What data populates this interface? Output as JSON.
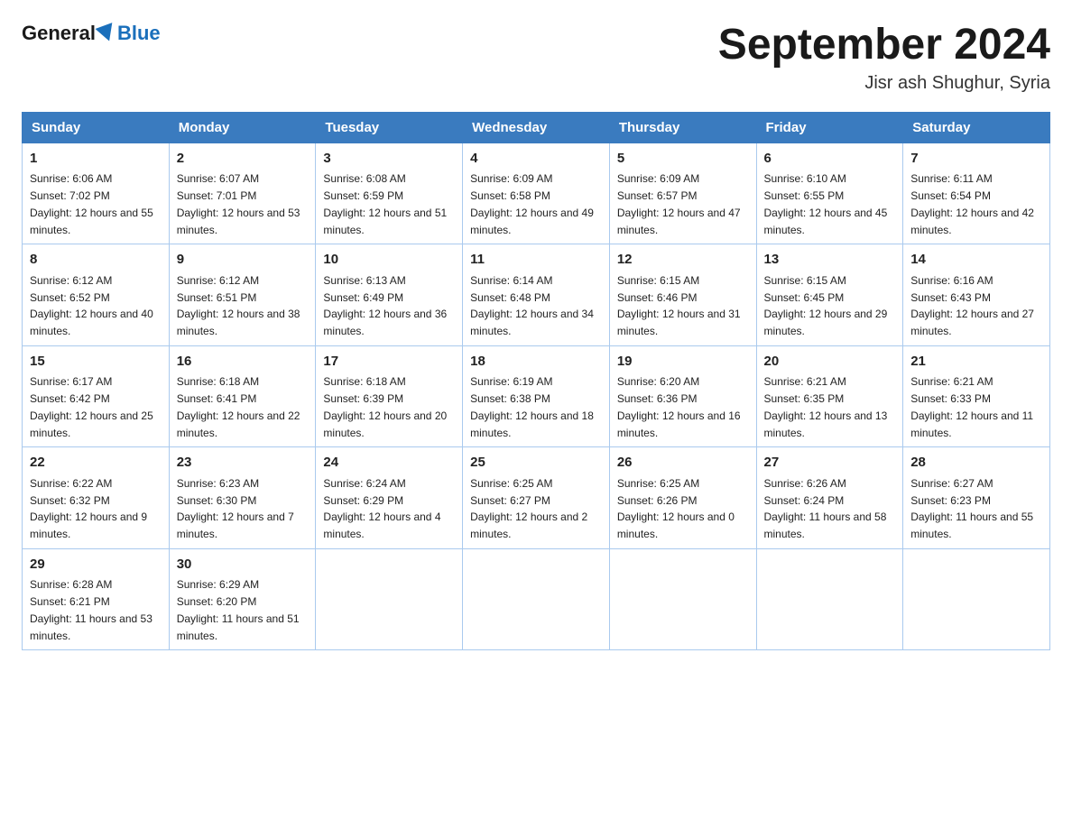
{
  "header": {
    "logo_general": "General",
    "logo_blue": "Blue",
    "month_title": "September 2024",
    "location": "Jisr ash Shughur, Syria"
  },
  "days_of_week": [
    "Sunday",
    "Monday",
    "Tuesday",
    "Wednesday",
    "Thursday",
    "Friday",
    "Saturday"
  ],
  "weeks": [
    [
      {
        "day": "1",
        "sunrise": "6:06 AM",
        "sunset": "7:02 PM",
        "daylight": "12 hours and 55 minutes."
      },
      {
        "day": "2",
        "sunrise": "6:07 AM",
        "sunset": "7:01 PM",
        "daylight": "12 hours and 53 minutes."
      },
      {
        "day": "3",
        "sunrise": "6:08 AM",
        "sunset": "6:59 PM",
        "daylight": "12 hours and 51 minutes."
      },
      {
        "day": "4",
        "sunrise": "6:09 AM",
        "sunset": "6:58 PM",
        "daylight": "12 hours and 49 minutes."
      },
      {
        "day": "5",
        "sunrise": "6:09 AM",
        "sunset": "6:57 PM",
        "daylight": "12 hours and 47 minutes."
      },
      {
        "day": "6",
        "sunrise": "6:10 AM",
        "sunset": "6:55 PM",
        "daylight": "12 hours and 45 minutes."
      },
      {
        "day": "7",
        "sunrise": "6:11 AM",
        "sunset": "6:54 PM",
        "daylight": "12 hours and 42 minutes."
      }
    ],
    [
      {
        "day": "8",
        "sunrise": "6:12 AM",
        "sunset": "6:52 PM",
        "daylight": "12 hours and 40 minutes."
      },
      {
        "day": "9",
        "sunrise": "6:12 AM",
        "sunset": "6:51 PM",
        "daylight": "12 hours and 38 minutes."
      },
      {
        "day": "10",
        "sunrise": "6:13 AM",
        "sunset": "6:49 PM",
        "daylight": "12 hours and 36 minutes."
      },
      {
        "day": "11",
        "sunrise": "6:14 AM",
        "sunset": "6:48 PM",
        "daylight": "12 hours and 34 minutes."
      },
      {
        "day": "12",
        "sunrise": "6:15 AM",
        "sunset": "6:46 PM",
        "daylight": "12 hours and 31 minutes."
      },
      {
        "day": "13",
        "sunrise": "6:15 AM",
        "sunset": "6:45 PM",
        "daylight": "12 hours and 29 minutes."
      },
      {
        "day": "14",
        "sunrise": "6:16 AM",
        "sunset": "6:43 PM",
        "daylight": "12 hours and 27 minutes."
      }
    ],
    [
      {
        "day": "15",
        "sunrise": "6:17 AM",
        "sunset": "6:42 PM",
        "daylight": "12 hours and 25 minutes."
      },
      {
        "day": "16",
        "sunrise": "6:18 AM",
        "sunset": "6:41 PM",
        "daylight": "12 hours and 22 minutes."
      },
      {
        "day": "17",
        "sunrise": "6:18 AM",
        "sunset": "6:39 PM",
        "daylight": "12 hours and 20 minutes."
      },
      {
        "day": "18",
        "sunrise": "6:19 AM",
        "sunset": "6:38 PM",
        "daylight": "12 hours and 18 minutes."
      },
      {
        "day": "19",
        "sunrise": "6:20 AM",
        "sunset": "6:36 PM",
        "daylight": "12 hours and 16 minutes."
      },
      {
        "day": "20",
        "sunrise": "6:21 AM",
        "sunset": "6:35 PM",
        "daylight": "12 hours and 13 minutes."
      },
      {
        "day": "21",
        "sunrise": "6:21 AM",
        "sunset": "6:33 PM",
        "daylight": "12 hours and 11 minutes."
      }
    ],
    [
      {
        "day": "22",
        "sunrise": "6:22 AM",
        "sunset": "6:32 PM",
        "daylight": "12 hours and 9 minutes."
      },
      {
        "day": "23",
        "sunrise": "6:23 AM",
        "sunset": "6:30 PM",
        "daylight": "12 hours and 7 minutes."
      },
      {
        "day": "24",
        "sunrise": "6:24 AM",
        "sunset": "6:29 PM",
        "daylight": "12 hours and 4 minutes."
      },
      {
        "day": "25",
        "sunrise": "6:25 AM",
        "sunset": "6:27 PM",
        "daylight": "12 hours and 2 minutes."
      },
      {
        "day": "26",
        "sunrise": "6:25 AM",
        "sunset": "6:26 PM",
        "daylight": "12 hours and 0 minutes."
      },
      {
        "day": "27",
        "sunrise": "6:26 AM",
        "sunset": "6:24 PM",
        "daylight": "11 hours and 58 minutes."
      },
      {
        "day": "28",
        "sunrise": "6:27 AM",
        "sunset": "6:23 PM",
        "daylight": "11 hours and 55 minutes."
      }
    ],
    [
      {
        "day": "29",
        "sunrise": "6:28 AM",
        "sunset": "6:21 PM",
        "daylight": "11 hours and 53 minutes."
      },
      {
        "day": "30",
        "sunrise": "6:29 AM",
        "sunset": "6:20 PM",
        "daylight": "11 hours and 51 minutes."
      },
      null,
      null,
      null,
      null,
      null
    ]
  ]
}
